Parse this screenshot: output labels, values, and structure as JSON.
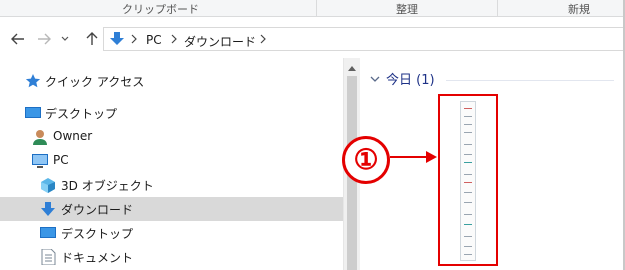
{
  "ribbon": {
    "groups": [
      "クリップボード",
      "整理",
      "新規"
    ]
  },
  "address": {
    "crumbs": [
      "PC",
      "ダウンロード"
    ]
  },
  "sidebar": {
    "items": [
      {
        "label": "クイック アクセス",
        "icon": "star-icon"
      },
      {
        "label": "デスクトップ",
        "icon": "desktop-icon"
      },
      {
        "label": "Owner",
        "icon": "user-icon"
      },
      {
        "label": "PC",
        "icon": "pc-icon"
      },
      {
        "label": "3D オブジェクト",
        "icon": "cube-icon"
      },
      {
        "label": "ダウンロード",
        "icon": "download-icon",
        "selected": true
      },
      {
        "label": "デスクトップ",
        "icon": "desktop-icon"
      },
      {
        "label": "ドキュメント",
        "icon": "document-icon"
      }
    ]
  },
  "content": {
    "group_header": "今日 (1)"
  },
  "annotation": {
    "marker": "①",
    "color": "#e40000"
  }
}
